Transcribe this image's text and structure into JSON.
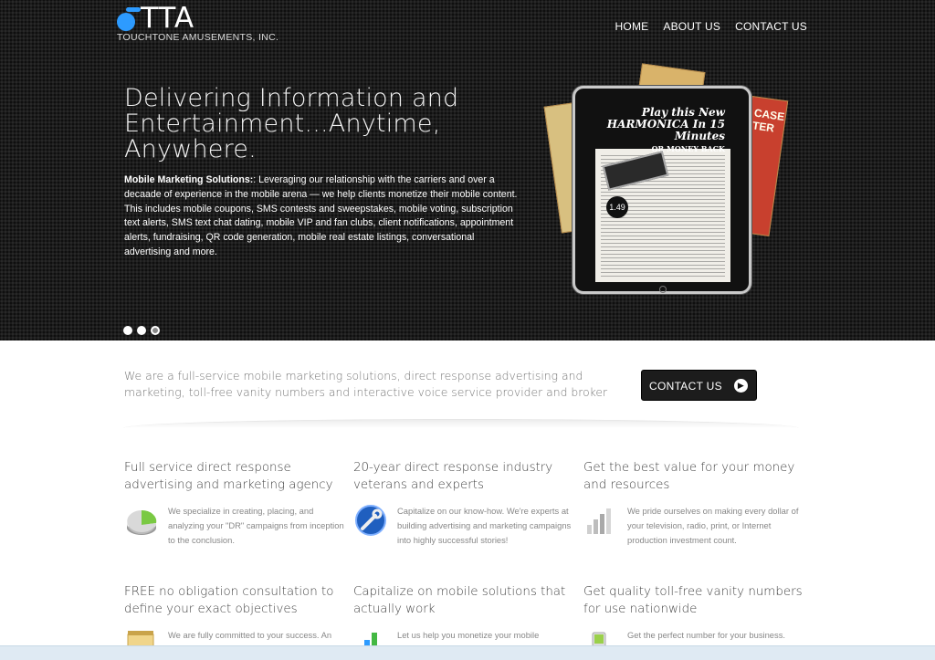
{
  "brand": {
    "logo_text": "TTA",
    "company": "TOUCHTONE AMUSEMENTS, INC."
  },
  "nav": {
    "items": [
      {
        "label": "HOME"
      },
      {
        "label": "ABOUT US"
      },
      {
        "label": "CONTACT US"
      }
    ]
  },
  "hero": {
    "title": "Delivering Information and Entertainment...Anytime, Anywhere.",
    "lead_bold": "Mobile Marketing Solutions:",
    "lead_text": ": Leveraging our relationship with the carriers and over a decaade of experience in the mobile arena — we help clients monetize their mobile content. This includes mobile coupons, SMS contests and sweepstakes, mobile voting, subscription text alerts, SMS text chat dating, mobile VIP and fan clubs, client notifications, appointment alerts, fundraising, QR code generation, mobile real estate listings, conversational advertising and more.",
    "slides": 3,
    "active_slide": 3,
    "ad": {
      "headline": "Play this New HARMONICA In 15 Minutes",
      "tagline": "OR MONEY BACK",
      "price": "1.49",
      "side_text": "CASE TER"
    }
  },
  "intro": {
    "text": "We are a full-service mobile marketing solutions, direct response advertising and marketing, toll-free vanity numbers and interactive voice service provider and broker",
    "cta_label": "CONTACT US"
  },
  "features": [
    {
      "title": "Full service direct response advertising and marketing agency",
      "text": "We specialize in creating, placing, and analyzing your \"DR\" campaigns from inception to the conclusion.",
      "icon": "pie-chart-icon"
    },
    {
      "title": "20-year direct response industry veterans and experts",
      "text": "Capitalize on our know-how. We're experts at building advertising and marketing campaigns into highly successful stories!",
      "icon": "wrench-globe-icon"
    },
    {
      "title": "Get the best value for your money and resources",
      "text": "We pride ourselves on making every dollar of your television, radio, print, or Internet production investment count.",
      "icon": "bar-chart-icon"
    },
    {
      "title": "FREE no obligation consultation to define your exact objectives",
      "text": "We are fully committed to your success. An",
      "icon": "notepad-icon"
    },
    {
      "title": "Capitalize on mobile solutions that actually work",
      "text": "Let us help you monetize your mobile",
      "icon": "color-bars-icon"
    },
    {
      "title": "Get quality toll-free vanity numbers for use nationwide",
      "text": "Get the perfect number for your business.",
      "icon": "phone-icon"
    }
  ],
  "colors": {
    "accent": "#2d9bff",
    "hero_bg": "#1c1c1c",
    "cta_bg": "#1c1c1c"
  }
}
